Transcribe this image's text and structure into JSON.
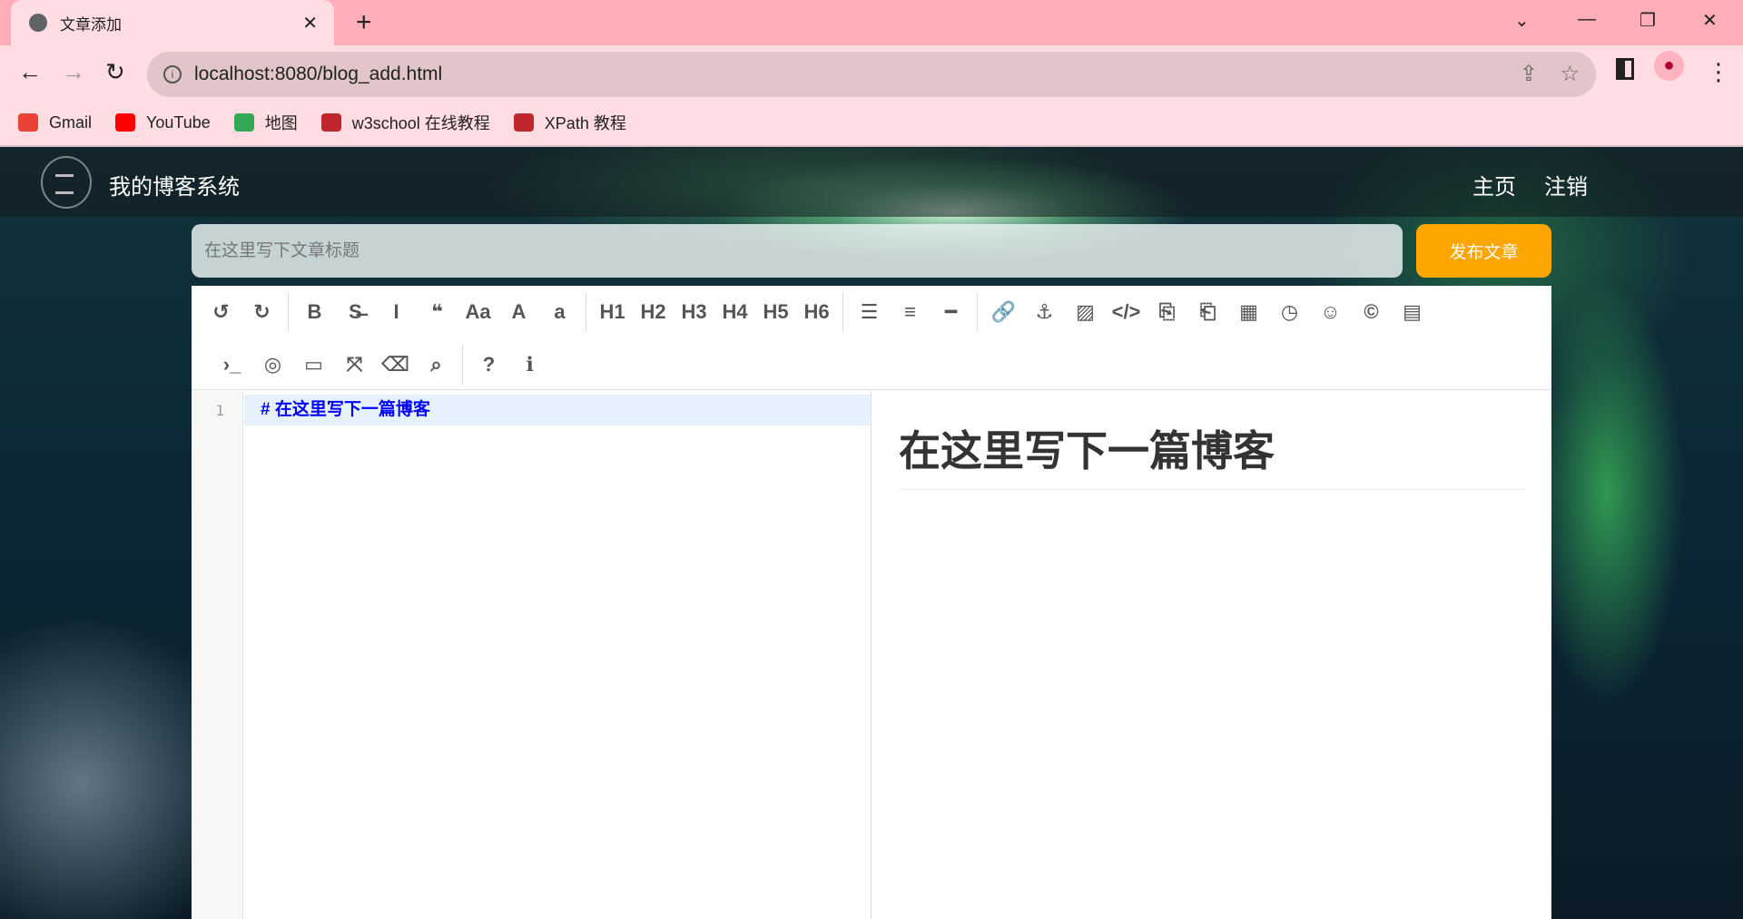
{
  "browser": {
    "tab_title": "文章添加",
    "url": "localhost:8080/blog_add.html",
    "bookmarks": [
      {
        "label": "Gmail",
        "color": "#ea4335"
      },
      {
        "label": "YouTube",
        "color": "#ff0000"
      },
      {
        "label": "地图",
        "color": "#34a853"
      },
      {
        "label": "w3school 在线教程",
        "color": "#c0272d"
      },
      {
        "label": "XPath 教程",
        "color": "#c0272d"
      }
    ]
  },
  "site": {
    "title": "我的博客系统",
    "nav": [
      "主页",
      "注销"
    ]
  },
  "form": {
    "title_placeholder": "在这里写下文章标题",
    "publish_label": "发布文章",
    "accent": "#ffa500"
  },
  "toolbar": {
    "row1": [
      [
        "undo-icon",
        "↺"
      ],
      [
        "redo-icon",
        "↻"
      ],
      "|",
      [
        "bold-icon",
        "B"
      ],
      [
        "strikethrough-icon",
        "S̶"
      ],
      [
        "italic-icon",
        "I"
      ],
      [
        "quote-icon",
        "❝"
      ],
      [
        "uppercase-icon",
        "Aa"
      ],
      [
        "uppercase-first-icon",
        "A"
      ],
      [
        "lowercase-icon",
        "a"
      ],
      "|",
      [
        "h1-button",
        "H1"
      ],
      [
        "h2-button",
        "H2"
      ],
      [
        "h3-button",
        "H3"
      ],
      [
        "h4-button",
        "H4"
      ],
      [
        "h5-button",
        "H5"
      ],
      [
        "h6-button",
        "H6"
      ],
      "|",
      [
        "unordered-list-icon",
        "☰"
      ],
      [
        "ordered-list-icon",
        "≡"
      ],
      [
        "horizontal-rule-icon",
        "━"
      ],
      "|",
      [
        "link-icon",
        "🔗"
      ],
      [
        "anchor-icon",
        "⚓"
      ],
      [
        "image-icon",
        "▨"
      ],
      [
        "code-icon",
        "</>"
      ],
      [
        "code-block-icon",
        "⎘"
      ],
      [
        "preformatted-icon",
        "⎗"
      ],
      [
        "table-icon",
        "▦"
      ],
      [
        "datetime-icon",
        "◷"
      ],
      [
        "emoji-icon",
        "☺"
      ],
      [
        "html-entities-icon",
        "©"
      ],
      [
        "pagebreak-icon",
        "▤"
      ]
    ],
    "row2": [
      [
        "goto-line-icon",
        "›_"
      ],
      [
        "watch-toggle-icon",
        "◎"
      ],
      [
        "preview-icon",
        "▭"
      ],
      [
        "fullscreen-icon",
        "⤧"
      ],
      [
        "clear-icon",
        "⌫"
      ],
      [
        "search-icon",
        "⌕"
      ],
      "|",
      [
        "help-icon",
        "?"
      ],
      [
        "info-icon",
        "ℹ"
      ]
    ]
  },
  "editor": {
    "line_number": "1",
    "line1": "#  在这里写下一篇博客",
    "preview_h1": "在这里写下一篇博客"
  }
}
